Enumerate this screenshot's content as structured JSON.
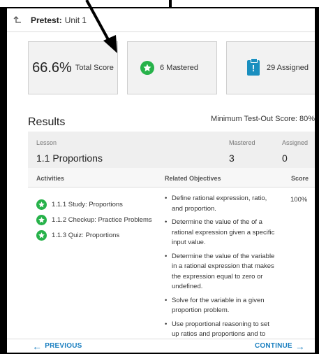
{
  "header": {
    "title_bold": "Pretest:",
    "title_rest": "Unit 1"
  },
  "summary": {
    "score_value": "66.6%",
    "score_label": "Total Score",
    "mastered_label": "6 Mastered",
    "assigned_label": "29 Assigned"
  },
  "results": {
    "title": "Results",
    "min_score": "Minimum Test-Out Score: 80%"
  },
  "lesson": {
    "lesson_label": "Lesson",
    "lesson_name": "1.1 Proportions",
    "mastered_label": "Mastered",
    "mastered_value": "3",
    "assigned_label": "Assigned",
    "assigned_value": "0"
  },
  "columns": {
    "activities": "Activities",
    "objectives": "Related Objectives",
    "score": "Score"
  },
  "activities": [
    "1.1.1  Study: Proportions",
    "1.1.2  Checkup: Practice Problems",
    "1.1.3  Quiz: Proportions"
  ],
  "objectives": [
    "Define rational expression, ratio, and proportion.",
    "Determine the value of the of a rational expression given a specific input value.",
    "Determine the value of the variable in a rational expression that makes the expression equal to zero or undefined.",
    "Solve for the variable in a given proportion problem.",
    "Use proportional reasoning to set up ratios and proportions and to solve real-life problems."
  ],
  "score": "100%",
  "footer": {
    "previous": "PREVIOUS",
    "continue": "CONTINUE"
  },
  "colors": {
    "green": "#27b24a",
    "blue": "#1a8fbf",
    "link": "#1a7fc0"
  }
}
